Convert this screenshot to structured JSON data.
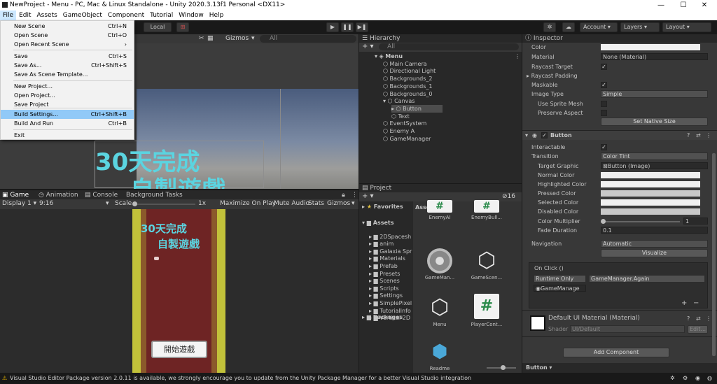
{
  "window": {
    "title": "NewProject - Menu - PC, Mac & Linux Standalone - Unity 2020.3.13f1 Personal <DX11>",
    "min": "—",
    "max": "☐",
    "close": "✕"
  },
  "menubar": [
    "File",
    "Edit",
    "Assets",
    "GameObject",
    "Component",
    "Tutorial",
    "Window",
    "Help"
  ],
  "file_menu": [
    {
      "label": "New Scene",
      "shortcut": "Ctrl+N"
    },
    {
      "label": "Open Scene",
      "shortcut": "Ctrl+O"
    },
    {
      "label": "Open Recent Scene",
      "shortcut": "›"
    },
    {
      "label": "Save",
      "shortcut": "Ctrl+S"
    },
    {
      "label": "Save As...",
      "shortcut": "Ctrl+Shift+S"
    },
    {
      "label": "Save As Scene Template...",
      "shortcut": ""
    },
    {
      "label": "New Project...",
      "shortcut": ""
    },
    {
      "label": "Open Project...",
      "shortcut": ""
    },
    {
      "label": "Save Project",
      "shortcut": ""
    },
    {
      "label": "Build Settings...",
      "shortcut": "Ctrl+Shift+B"
    },
    {
      "label": "Build And Run",
      "shortcut": "Ctrl+B"
    },
    {
      "label": "Exit",
      "shortcut": ""
    }
  ],
  "toolbar": {
    "local": "Local",
    "account": "Account",
    "layers": "Layers",
    "layout": "Layout",
    "play": "▶",
    "pause": "❚❚",
    "step": "▶❚"
  },
  "scene_view": {
    "gizmos": "Gizmos",
    "search": "All",
    "overlay_line1": "30天完成",
    "overlay_line2": "自製遊戲"
  },
  "game_tabs": {
    "game": "Game",
    "animation": "Animation",
    "console": "Console",
    "background": "Background Tasks"
  },
  "game_bar": {
    "display": "Display 1",
    "aspect": "9:16",
    "scale_label": "Scale",
    "scale_value": "1x",
    "maximize": "Maximize On Play",
    "mute": "Mute Audio",
    "stats": "Stats",
    "gizmos": "Gizmos"
  },
  "game_view": {
    "line1": "30天完成",
    "line2": "自製遊戲",
    "button": "開始遊戲"
  },
  "hierarchy": {
    "tab": "Hierarchy",
    "search": "All",
    "items": [
      {
        "label": "Menu",
        "depth": 0
      },
      {
        "label": "Main Camera",
        "depth": 1
      },
      {
        "label": "Directional Light",
        "depth": 1
      },
      {
        "label": "Backgrounds_2",
        "depth": 1
      },
      {
        "label": "Backgrounds_1",
        "depth": 1
      },
      {
        "label": "Backgrounds_0",
        "depth": 1
      },
      {
        "label": "Canvas",
        "depth": 1
      },
      {
        "label": "Button",
        "depth": 2
      },
      {
        "label": "Text",
        "depth": 2
      },
      {
        "label": "EventSystem",
        "depth": 1
      },
      {
        "label": "Enemy A",
        "depth": 1
      },
      {
        "label": "GameManager",
        "depth": 1
      }
    ]
  },
  "project": {
    "tab": "Project",
    "count": "16",
    "favorites": "Favorites",
    "assets_header": "Assets",
    "packages": "Packages",
    "tree": [
      "Assets",
      "2DSpacesh",
      "anim",
      "Galaxia Spr",
      "Materials",
      "Prefab",
      "Presets",
      "Scenes",
      "Scripts",
      "Settings",
      "SimplePixel",
      "TutorialInfo",
      "Vertical 2D"
    ],
    "grid": [
      "EnemyAI",
      "EnemyBull...",
      "GameMan...",
      "GameScen...",
      "Menu",
      "PlayerCont...",
      "Readme"
    ]
  },
  "inspector": {
    "tab": "Inspector",
    "image": {
      "color": "Color",
      "material": "Material",
      "material_val": "None (Material)",
      "raycast": "Raycast Target",
      "padding": "Raycast Padding",
      "maskable": "Maskable",
      "image_type": "Image Type",
      "image_type_val": "Simple",
      "sprite_mesh": "Use Sprite Mesh",
      "preserve": "Preserve Aspect",
      "native": "Set Native Size"
    },
    "button": {
      "title": "Button",
      "interactable": "Interactable",
      "transition": "Transition",
      "transition_val": "Color Tint",
      "target": "Target Graphic",
      "target_val": "Button (Image)",
      "normal": "Normal Color",
      "highlighted": "Highlighted Color",
      "pressed": "Pressed Color",
      "selected": "Selected Color",
      "disabled": "Disabled Color",
      "multiplier": "Color Multiplier",
      "multiplier_val": "1",
      "fade": "Fade Duration",
      "fade_val": "0.1",
      "navigation": "Navigation",
      "navigation_val": "Automatic",
      "visualize": "Visualize",
      "onclick": "On Click ()",
      "runtime": "Runtime Only",
      "function": "GameManager.Again",
      "object": "GameManage"
    },
    "material": {
      "title": "Default UI Material (Material)",
      "shader": "Shader",
      "shader_val": "UI/Default",
      "edit": "Edit..."
    },
    "add_component": "Add Component",
    "footer": "Button"
  },
  "status": {
    "message": "Visual Studio Editor Package version 2.0.11 is available, we strongly encourage you to update from the Unity Package Manager for a better Visual Studio integration"
  }
}
